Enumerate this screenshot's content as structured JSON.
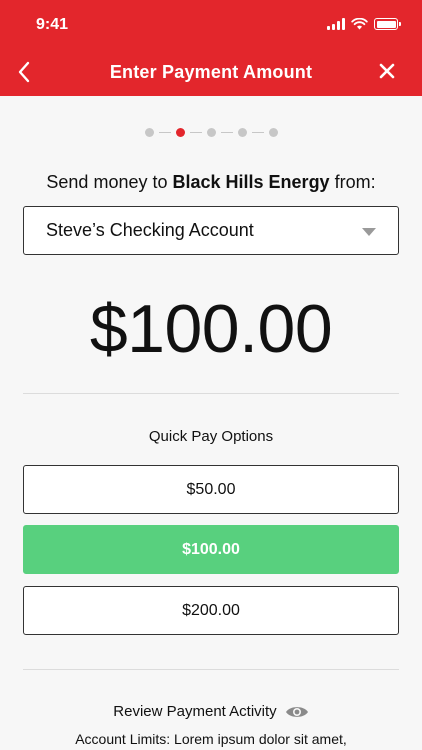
{
  "status": {
    "time": "9:41"
  },
  "nav": {
    "title": "Enter Payment Amount"
  },
  "progress": {
    "total_steps": 5,
    "current_step": 2
  },
  "send": {
    "prefix": "Send money to ",
    "payee": "Black Hills Energy",
    "suffix": " from:"
  },
  "account": {
    "selected": "Steve’s Checking Account"
  },
  "amount": {
    "value": "$100.00"
  },
  "quick_pay": {
    "title": "Quick Pay Options",
    "options": [
      "$50.00",
      "$100.00",
      "$200.00"
    ],
    "selected_index": 1
  },
  "review": {
    "label": "Review Payment Activity"
  },
  "limits": {
    "text": "Account Limits: Lorem ipsum dolor sit amet,"
  },
  "colors": {
    "brand_red": "#e3262c",
    "selected_green": "#58d07e"
  }
}
